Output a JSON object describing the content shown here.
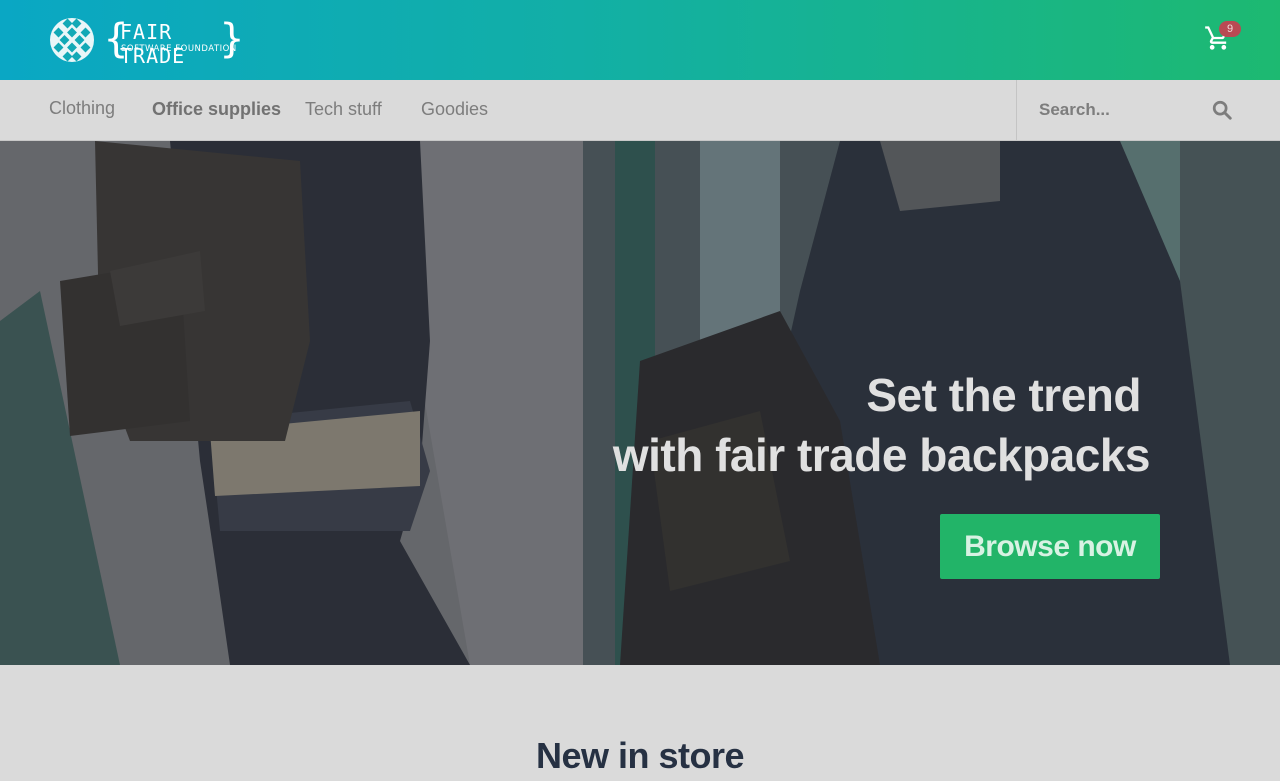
{
  "header": {
    "logo": {
      "title": "FAIR TRADE",
      "subtitle": "SOFTWARE FOUNDATION",
      "icon": "logo-mark-icon"
    },
    "cart": {
      "icon": "shopping-cart-icon",
      "count": "9"
    },
    "colors": {
      "gradient_start": "#0aa7c4",
      "gradient_end": "#1db971",
      "badge": "#b94a53"
    }
  },
  "nav": {
    "items": [
      {
        "label": "Clothing"
      },
      {
        "label": "Office supplies"
      },
      {
        "label": "Tech stuff"
      },
      {
        "label": "Goodies"
      }
    ],
    "search": {
      "placeholder": "Search...",
      "value": "",
      "icon": "search-icon"
    }
  },
  "hero": {
    "title_line1": "Set the trend",
    "title_line2": "with fair trade backpacks",
    "button_label": "Browse now",
    "button_color": "#22b468"
  },
  "main": {
    "section_title": "New in store"
  }
}
